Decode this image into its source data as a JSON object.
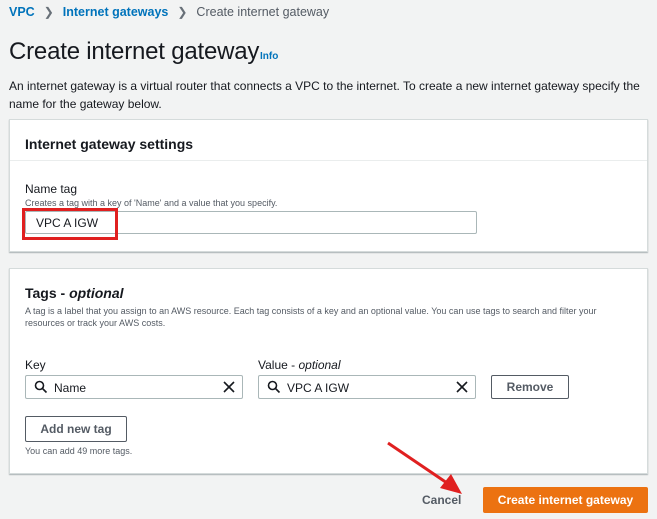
{
  "breadcrumb": {
    "items": [
      "VPC",
      "Internet gateways"
    ],
    "current": "Create internet gateway"
  },
  "page": {
    "title": "Create internet gateway",
    "info": "Info",
    "description": "An internet gateway is a virtual router that connects a VPC to the internet. To create a new internet gateway specify the name for the gateway below."
  },
  "settings": {
    "title": "Internet gateway settings",
    "name_label": "Name tag",
    "name_desc": "Creates a tag with a key of 'Name' and a value that you specify.",
    "name_value": "VPC A IGW"
  },
  "tags": {
    "title": "Tags - ",
    "title_optional": "optional",
    "description": "A tag is a label that you assign to an AWS resource. Each tag consists of a key and an optional value. You can use tags to search and filter your resources or track your AWS costs.",
    "key_label": "Key",
    "value_label": "Value - ",
    "value_optional": "optional",
    "key_value": "Name",
    "value_value": "VPC A IGW",
    "remove_label": "Remove",
    "add_label": "Add new tag",
    "hint": "You can add 49 more tags."
  },
  "footer": {
    "cancel": "Cancel",
    "create": "Create internet gateway"
  },
  "colors": {
    "link": "#0073bb",
    "primary": "#ec7211",
    "highlight": "#e02020"
  }
}
